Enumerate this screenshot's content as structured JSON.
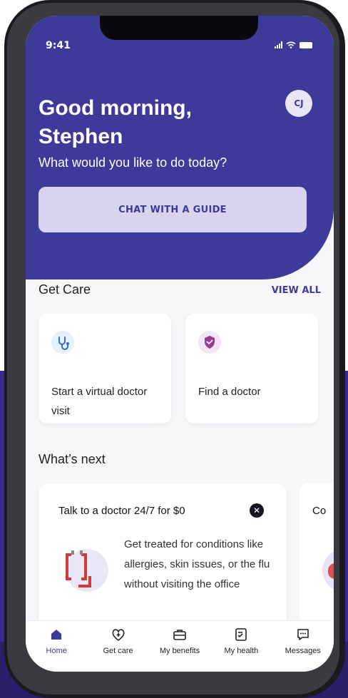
{
  "status": {
    "time": "9:41"
  },
  "header": {
    "greeting": "Good morning, Stephen",
    "avatar_initials": "CJ",
    "subtitle": "What would you like to do today?",
    "chat_button_label": "CHAT WITH A GUIDE"
  },
  "get_care": {
    "title": "Get Care",
    "view_all_label": "VIEW ALL",
    "cards": [
      {
        "label": "Start a virtual doctor visit",
        "icon": "stethoscope-icon"
      },
      {
        "label": "Find a doctor",
        "icon": "shield-check-icon"
      }
    ]
  },
  "whats_next": {
    "title": "What’s next",
    "card": {
      "title": "Talk to a doctor 24/7 for $0",
      "body": "Get treated for conditions like allergies, skin issues, or the flu without visiting the office"
    },
    "peek_card_title": "Co"
  },
  "tabbar": {
    "items": [
      {
        "label": "Home",
        "icon": "home-icon",
        "active": true
      },
      {
        "label": "Get care",
        "icon": "heart-plus-icon",
        "active": false
      },
      {
        "label": "My benefits",
        "icon": "briefcase-icon",
        "active": false
      },
      {
        "label": "My health",
        "icon": "health-record-icon",
        "active": false
      },
      {
        "label": "Messages",
        "icon": "message-icon",
        "active": false
      }
    ]
  },
  "colors": {
    "brand": "#3d3a9a",
    "chat_button_bg": "#d8d4f0",
    "background_purple": "#3b2a8c"
  }
}
